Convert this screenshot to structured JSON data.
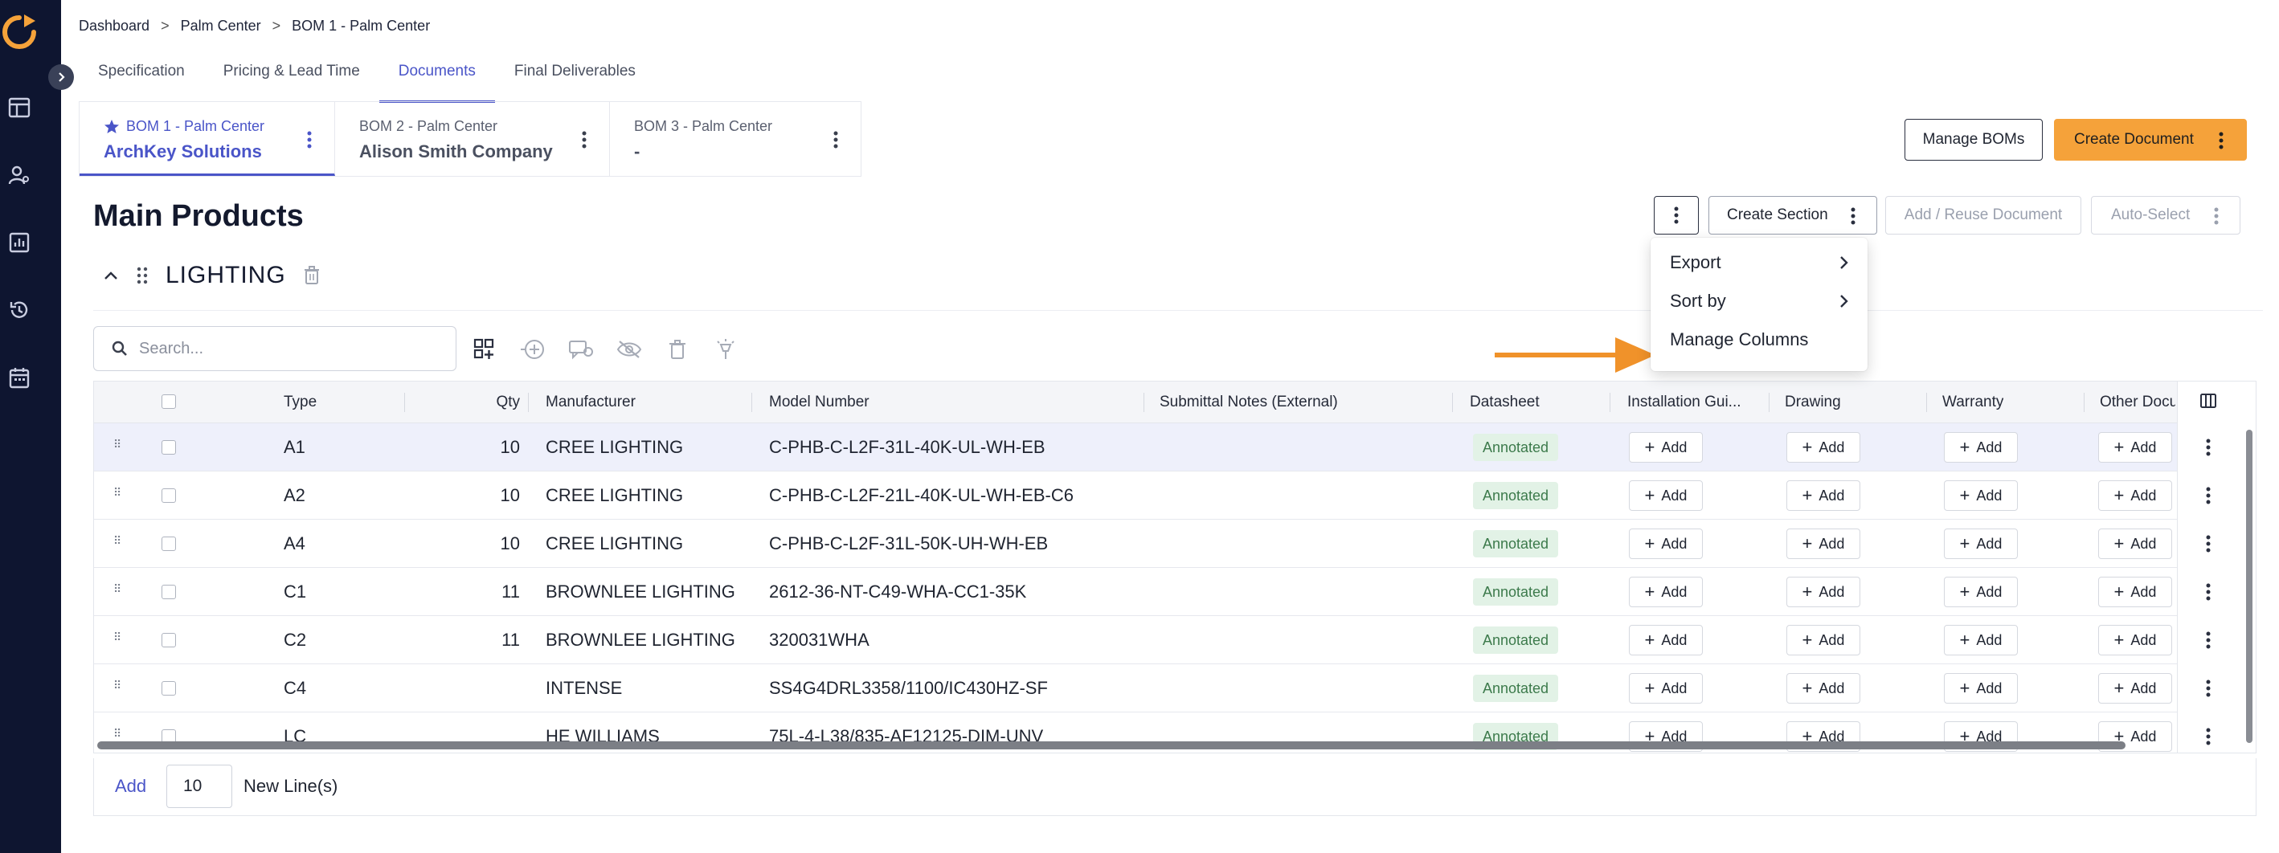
{
  "breadcrumb": [
    "Dashboard",
    "Palm Center",
    "BOM 1 - Palm Center"
  ],
  "breadcrumb_separator": ">",
  "tabs": [
    {
      "label": "Specification"
    },
    {
      "label": "Pricing & Lead Time"
    },
    {
      "label": "Documents",
      "active": true
    },
    {
      "label": "Final Deliverables"
    }
  ],
  "boms": [
    {
      "sub": "BOM 1 - Palm Center",
      "name": "ArchKey Solutions",
      "active": true,
      "starred": true
    },
    {
      "sub": "BOM 2 - Palm Center",
      "name": "Alison Smith Company"
    },
    {
      "sub": "BOM 3 - Palm Center",
      "name": "-"
    }
  ],
  "header_actions": {
    "manage_boms": "Manage BOMs",
    "create_document": "Create Document"
  },
  "main_title": "Main Products",
  "toolbar": {
    "create_section": "Create Section",
    "add_reuse": "Add / Reuse Document",
    "auto_select": "Auto-Select"
  },
  "menu": {
    "items": [
      {
        "label": "Export",
        "submenu": true
      },
      {
        "label": "Sort by",
        "submenu": true
      },
      {
        "label": "Manage Columns",
        "submenu": false
      }
    ]
  },
  "section": {
    "title": "LIGHTING"
  },
  "search": {
    "placeholder": "Search..."
  },
  "table": {
    "columns": {
      "type": "Type",
      "qty": "Qty",
      "manufacturer": "Manufacturer",
      "model": "Model Number",
      "notes": "Submittal Notes (External)",
      "datasheet": "Datasheet",
      "installation": "Installation Gui...",
      "drawing": "Drawing",
      "warranty": "Warranty",
      "other": "Other Docum"
    },
    "add_label": "Add",
    "rows": [
      {
        "type": "A1",
        "qty": "10",
        "manufacturer": "CREE LIGHTING",
        "model": "C-PHB-C-L2F-31L-40K-UL-WH-EB",
        "notes": "",
        "datasheet": "Annotated",
        "selected": true
      },
      {
        "type": "A2",
        "qty": "10",
        "manufacturer": "CREE LIGHTING",
        "model": "C-PHB-C-L2F-21L-40K-UL-WH-EB-C6",
        "notes": "",
        "datasheet": "Annotated"
      },
      {
        "type": "A4",
        "qty": "10",
        "manufacturer": "CREE LIGHTING",
        "model": "C-PHB-C-L2F-31L-50K-UH-WH-EB",
        "notes": "",
        "datasheet": "Annotated"
      },
      {
        "type": "C1",
        "qty": "11",
        "manufacturer": "BROWNLEE LIGHTING",
        "model": "2612-36-NT-C49-WHA-CC1-35K",
        "notes": "",
        "datasheet": "Annotated"
      },
      {
        "type": "C2",
        "qty": "11",
        "manufacturer": "BROWNLEE LIGHTING",
        "model": "320031WHA",
        "notes": "",
        "datasheet": "Annotated"
      },
      {
        "type": "C4",
        "qty": "",
        "manufacturer": "INTENSE",
        "model": "SS4G4DRL3358/1100/IC430HZ-SF",
        "notes": "",
        "datasheet": "Annotated"
      },
      {
        "type": "LC",
        "qty": "",
        "manufacturer": "HE WILLIAMS",
        "model": "75L-4-L38/835-AF12125-DIM-UNV",
        "notes": "",
        "datasheet": "Annotated"
      }
    ]
  },
  "footer": {
    "add": "Add",
    "count": "10",
    "suffix": "New Line(s)"
  },
  "colors": {
    "accent": "#4a55c8",
    "orange": "#f5a23a",
    "nav": "#0e1530",
    "badge_bg": "#e2f2e6"
  }
}
